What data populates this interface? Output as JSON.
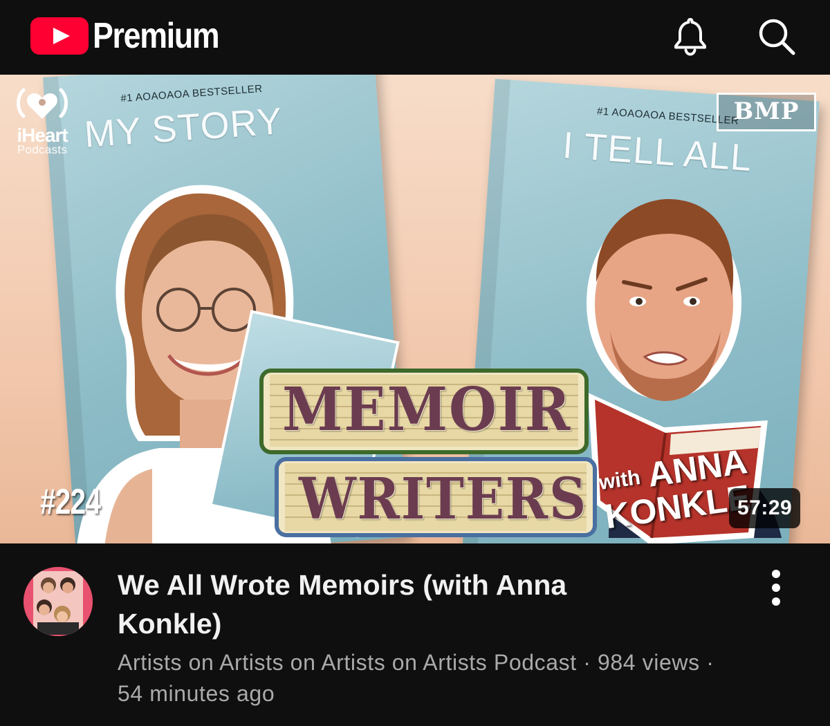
{
  "header": {
    "brand": "Premium",
    "icons": [
      "youtube-logo-icon",
      "bell-icon",
      "search-icon"
    ]
  },
  "thumbnail": {
    "network_name": "iHeart",
    "network_sub": "Podcasts",
    "left_book": {
      "badge": "#1 AOAOAOA BESTSELLER",
      "title": "MY STORY"
    },
    "right_book": {
      "badge": "#1 AOAOAOA BESTSELLER",
      "title": "I TELL ALL"
    },
    "label_logo": "BMP",
    "episode_number": "#224",
    "headline_top": "MEMOIR",
    "headline_bottom": "WRITERS",
    "guest_with": "with",
    "guest_first": "ANNA",
    "guest_last": "KONKLE",
    "duration": "57:29"
  },
  "video": {
    "title": "We All Wrote Memoirs (with Anna Konkle)",
    "channel": "Artists on Artists on Artists on Artists Podcast",
    "separator": "·",
    "views": "984 views",
    "age": "54 minutes ago"
  },
  "colors": {
    "background": "#0f0f0f",
    "brand_red": "#ff0033",
    "title_text": "#f1f1f1",
    "meta_text": "#aaaaaa",
    "book_blue": "#8dbcc7",
    "memoir_purple": "#6b3c4f"
  }
}
